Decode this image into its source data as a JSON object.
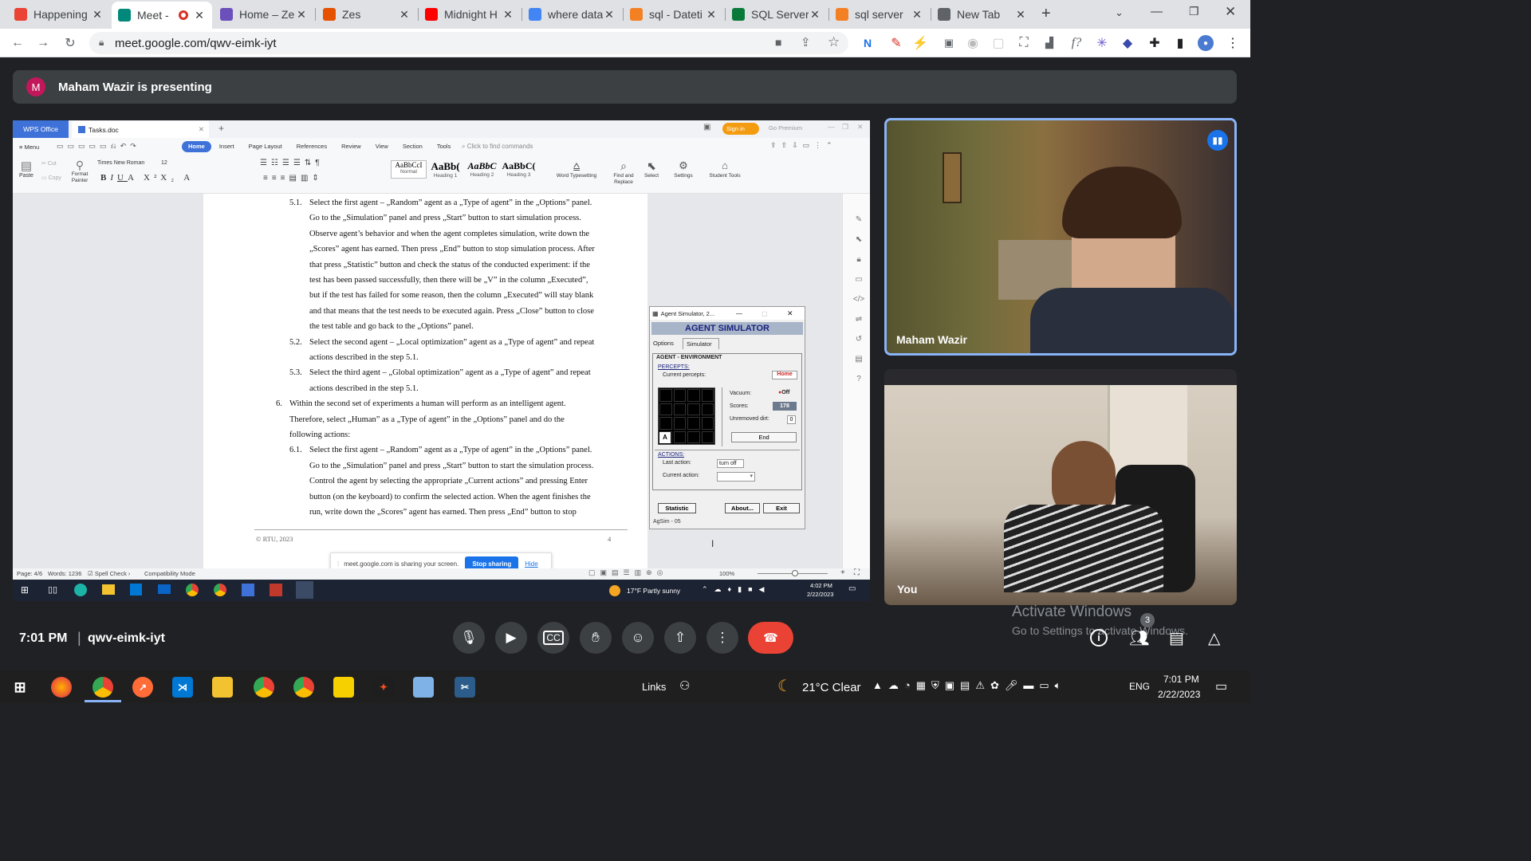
{
  "browser": {
    "tabs": [
      {
        "title": "Happening",
        "icon": "gmail-icon",
        "color": "#ea4335"
      },
      {
        "title": "Meet -",
        "icon": "meet-icon",
        "color": "#00897b",
        "recording": true
      },
      {
        "title": "Home – Ze",
        "icon": "s-icon",
        "color": "#6b4fbb"
      },
      {
        "title": "Zes",
        "icon": "z-icon",
        "color": "#e65100"
      },
      {
        "title": "Midnight H",
        "icon": "youtube-icon",
        "color": "#ff0000"
      },
      {
        "title": "where data",
        "icon": "google-icon",
        "color": "#4285f4"
      },
      {
        "title": "sql - Dateti",
        "icon": "stackoverflow-icon",
        "color": "#f48024"
      },
      {
        "title": "SQL Server",
        "icon": "w-icon",
        "color": "#0a7a3a"
      },
      {
        "title": "sql server",
        "icon": "stackoverflow-icon",
        "color": "#f48024"
      },
      {
        "title": "New Tab",
        "icon": "chrome-icon",
        "color": "#5f6368"
      }
    ],
    "url": "meet.google.com/qwv-eimk-iyt"
  },
  "meet": {
    "presenter_initial": "M",
    "presenting_text": "Maham Wazir is presenting",
    "tile1_name": "Maham Wazir",
    "tile2_name": "You",
    "meeting_time": "7:01 PM",
    "meeting_code": "qwv-eimk-iyt",
    "people_count": "3",
    "activate_title": "Activate Windows",
    "activate_sub": "Go to Settings to activate Windows."
  },
  "wps": {
    "app_tab": "WPS Office",
    "doc_tab": "Tasks.doc",
    "signin": "Sign in",
    "premium": "Go Premium",
    "menu_label": "Menu",
    "menu_tabs": [
      "Home",
      "Insert",
      "Page Layout",
      "References",
      "Review",
      "View",
      "Section",
      "Tools"
    ],
    "search_placeholder": "Click to find commands",
    "font": "Times New Roman",
    "size": "12",
    "styles": [
      "Normal",
      "Heading 1",
      "Heading 2",
      "Heading 3"
    ],
    "style_samples": [
      "AaBbCcI",
      "AaBb(",
      "AaBbC",
      "AaBbC("
    ],
    "tools": [
      "Word Typesetting",
      "Find and Replace",
      "Select",
      "Settings",
      "Student Tools"
    ],
    "paste": "Paste",
    "cut": "Cut",
    "copy": "Copy",
    "format_painter": "Format Painter",
    "footer_left": "© RTU, 2023",
    "footer_page": "4",
    "status_page": "Page: 4/6",
    "status_words": "Words: 1236",
    "status_spell": "Spell Check",
    "status_compat": "Compatibility Mode",
    "zoom": "100%",
    "share_msg": "meet.google.com is sharing your screen.",
    "stop_sharing": "Stop sharing",
    "hide": "Hide",
    "weather_inner": "17°F  Partly sunny",
    "time_inner": "4:02 PM",
    "date_inner": "2/22/2023"
  },
  "doc_lines": [
    {
      "indent": 1,
      "num": "5.1.",
      "text": "Select the first agent – „Random” agent as a „Type of agent” in the „Options” panel."
    },
    {
      "indent": 2,
      "text": "Go to the „Simulation” panel and press „Start” button to start simulation process."
    },
    {
      "indent": 2,
      "text": "Observe agent’s behavior and when the agent completes simulation, write down the"
    },
    {
      "indent": 2,
      "text": "„Scores” agent has earned. Then press „End” button to stop simulation process. After"
    },
    {
      "indent": 2,
      "text": "that press „Statistic” button and check the status of the conducted experiment: if the"
    },
    {
      "indent": 2,
      "text": "test has been passed successfully, then there will be „V” in the column „Executed”,"
    },
    {
      "indent": 2,
      "text": "but if the test has failed for some reason, then the column „Executed” will stay blank"
    },
    {
      "indent": 2,
      "text": "and that means that the test needs to be executed again. Press „Close” button to close"
    },
    {
      "indent": 2,
      "text": "the test table and go back to the „Options” panel."
    },
    {
      "indent": 1,
      "num": "5.2.",
      "text": "Select the second agent – „Local optimization” agent as a „Type of agent” and repeat"
    },
    {
      "indent": 2,
      "text": "actions described in the step 5.1."
    },
    {
      "indent": 1,
      "num": "5.3.",
      "text": "Select the third agent – „Global optimization” agent as a „Type of agent” and repeat"
    },
    {
      "indent": 2,
      "text": "actions described in the step 5.1."
    },
    {
      "indent": 0,
      "num": "6.",
      "text": "Within the second set of experiments a human will perform as an intelligent agent."
    },
    {
      "indent": 3,
      "text": "Therefore, select „Human” as a „Type of agent” in the „Options” panel and do the"
    },
    {
      "indent": 3,
      "text": "following actions:"
    },
    {
      "indent": 1,
      "num": "6.1.",
      "text": "Select the first agent – „Random” agent as a „Type of agent” in the „Options” panel."
    },
    {
      "indent": 2,
      "text": "Go to the „Simulation” panel and press „Start” button to start the simulation process."
    },
    {
      "indent": 2,
      "text": "Control the agent by selecting the appropriate „Current actions” and pressing Enter"
    },
    {
      "indent": 2,
      "text": "button (on the keyboard) to confirm the selected action. When the agent finishes the"
    },
    {
      "indent": 2,
      "text": "run, write down the „Scores” agent has earned. Then press „End” button to stop"
    }
  ],
  "agent_sim": {
    "window_title": "Agent Simulator, 2...",
    "header": "AGENT SIMULATOR",
    "tab_options": "Options",
    "tab_simulator": "Simulator",
    "section": "AGENT - ENVIRONMENT",
    "percepts_label": "PERCEPTS:",
    "current_percepts_label": "Current percepts:",
    "current_percepts_value": "Home",
    "grid_marker": "A",
    "vacuum_label": "Vacuum:",
    "vacuum_value": "Off",
    "scores_label": "Scores:",
    "scores_value": "178",
    "unremoved_label": "Unremoved dirt:",
    "unremoved_value": "0",
    "end_button": "End",
    "actions_label": "ACTIONS:",
    "last_action_label": "Last action:",
    "last_action_value": "turn off",
    "current_action_label": "Current action:",
    "statistic_button": "Statistic",
    "about_button": "About...",
    "exit_button": "Exit",
    "status": "AgSim - 05"
  },
  "taskbar": {
    "links": "Links",
    "weather": "21°C  Clear",
    "lang": "ENG",
    "time": "7:01 PM",
    "date": "2/22/2023"
  }
}
